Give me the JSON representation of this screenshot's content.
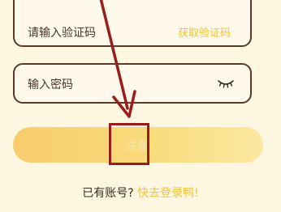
{
  "form": {
    "code_placeholder": "请输入验证码",
    "get_code_label": "获取验证码",
    "password_placeholder": "输入密码",
    "register_label": "注册"
  },
  "footer": {
    "prompt": "已有账号?",
    "login_link": "快去登录鸭!"
  },
  "icons": {
    "password_toggle": "eye-closed-icon"
  },
  "colors": {
    "background": "#fdf6e1",
    "field_border": "#5b3a29",
    "accent": "#f4c430",
    "button": "#f8d574",
    "annotation": "#9b1c1c"
  }
}
